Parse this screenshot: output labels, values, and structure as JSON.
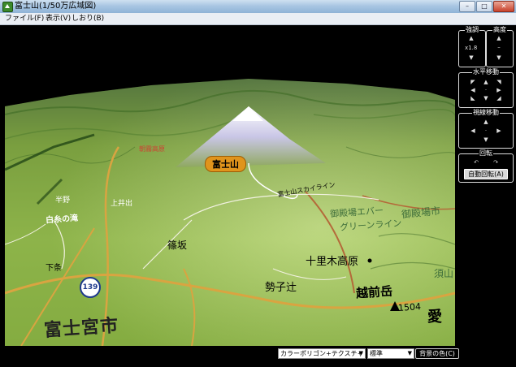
{
  "window": {
    "title": "富士山(1/50万広域図)",
    "controls": {
      "minimize": "–",
      "maximize": "□",
      "close": "✕"
    }
  },
  "menu": [
    {
      "label": "ファイル(F)"
    },
    {
      "label": "表示(V)"
    },
    {
      "label": "しおり(B)"
    }
  ],
  "map_labels": {
    "mount_fuji": "富士山",
    "skyline": "富士山スカイライン",
    "kamiido": "上井出",
    "koido": "半野",
    "nishi": "白糸の滝",
    "nishiyama": "朝霧高原",
    "shinozaka": "篠坂",
    "shimojo": "下条",
    "juri": "十里木高原",
    "ebashi": "勢子辻",
    "koshimae": "越前岳",
    "city": "富士宮市",
    "skyline2": "御殿場エバー",
    "skyline3": "グリーンライン",
    "gotenba": "御殿場市",
    "nagao": "須山",
    "elev": "1504",
    "edge": "愛",
    "route": "139"
  },
  "panel": {
    "emphasis": {
      "title": "強調",
      "value": "x1.8"
    },
    "height": {
      "title": "高度"
    },
    "horizontal": {
      "title": "水平移動"
    },
    "view": {
      "title": "視線移動"
    },
    "rotate": {
      "title": "回転",
      "auto_button": "自動回転(A)"
    }
  },
  "statusbar": {
    "render_mode": "カラーポリゴン+テクスチャー",
    "quality": "標準",
    "bg_button": "背景の色(C)"
  },
  "colors": {
    "terrain_light": "#b7d45a",
    "terrain_dark": "#4e8a2a",
    "road_yellow": "#d9a441",
    "label_orange": "#e0941c"
  }
}
